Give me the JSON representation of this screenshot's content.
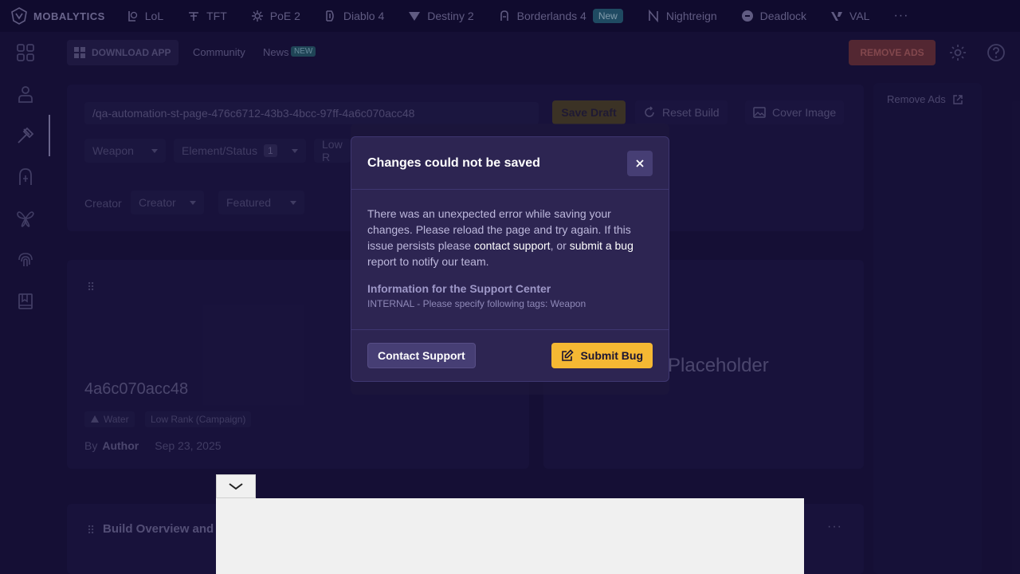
{
  "topnav": {
    "logo_text": "MOBALYTICS",
    "games": [
      {
        "label": "LoL",
        "icon": "lol-icon"
      },
      {
        "label": "TFT",
        "icon": "tft-icon"
      },
      {
        "label": "PoE 2",
        "icon": "poe2-icon"
      },
      {
        "label": "Diablo 4",
        "icon": "diablo4-icon"
      },
      {
        "label": "Destiny 2",
        "icon": "destiny2-icon"
      },
      {
        "label": "Borderlands 4",
        "icon": "borderlands4-icon",
        "badge": "New"
      },
      {
        "label": "Nightreign",
        "icon": "nightreign-icon"
      },
      {
        "label": "Deadlock",
        "icon": "deadlock-icon"
      },
      {
        "label": "VAL",
        "icon": "valorant-icon"
      }
    ],
    "more": "···"
  },
  "header": {
    "download_label": "DOWNLOAD APP",
    "community_label": "Community",
    "news_label": "News",
    "news_badge": "NEW",
    "remove_ads_label": "REMOVE ADS"
  },
  "editor": {
    "url_value": "/qa-automation-st-page-476c6712-43b3-4bcc-97ff-4a6c070acc48",
    "save_draft_label": "Save Draft",
    "reset_build_label": "Reset Build",
    "cover_image_label": "Cover Image",
    "weapon_label": "Weapon",
    "element_status_label": "Element/Status",
    "element_status_count": "1",
    "rank_label": "Low R",
    "creator_label": "Creator",
    "creator_select": "Creator",
    "featured_label": "Featured"
  },
  "build": {
    "title": "4a6c070acc48",
    "tags": [
      "Water",
      "Low Rank (Campaign)"
    ],
    "by": "By",
    "author": "Author",
    "date": "Sep 23, 2025",
    "placeholder": "Placeholder",
    "section_title": "Build Overview and"
  },
  "side": {
    "remove_ads_link": "Remove Ads"
  },
  "modal": {
    "title": "Changes could not be saved",
    "msg_part1": "There was an unexpected error while saving your changes. Please reload the page and try again. If this issue persists please ",
    "msg_link1": "contact support",
    "msg_part2": ", or ",
    "msg_link2": "submit a bug",
    "msg_part3": " report to notify our team.",
    "info_title": "Information for the Support Center",
    "info_text": "INTERNAL - Please specify following tags: Weapon",
    "contact_button": "Contact Support",
    "submit_button": "Submit Bug"
  },
  "colors": {
    "background": "#1c1543",
    "modal_bg": "#2d2552",
    "accent_yellow": "#f5b833",
    "new_badge": "#2c6f87"
  }
}
